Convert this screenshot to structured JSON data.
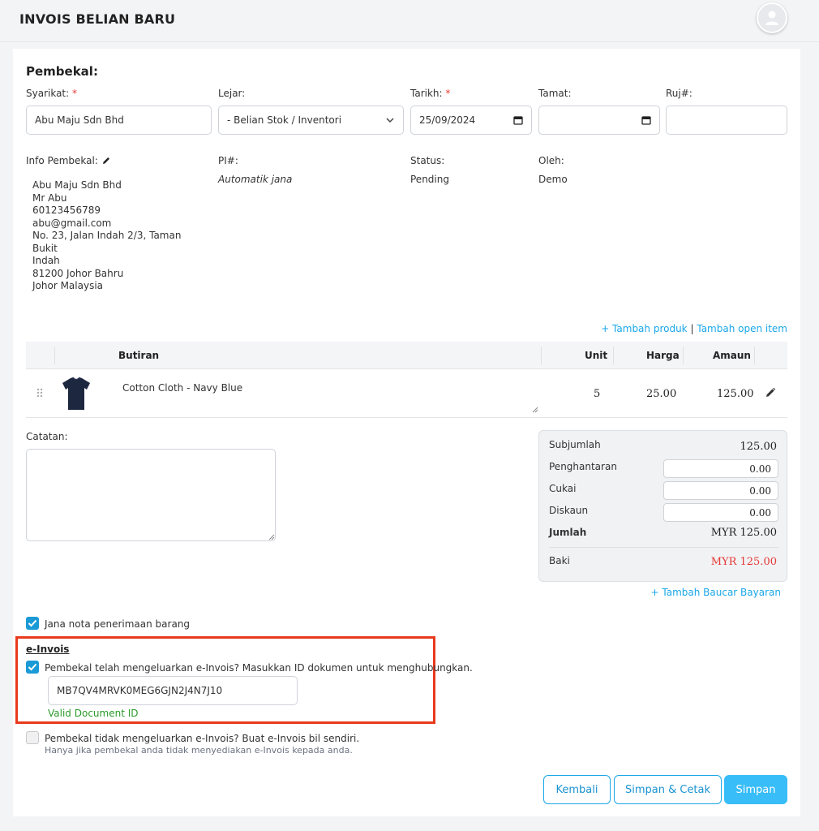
{
  "header": {
    "title": "INVOIS BELIAN BARU",
    "avatar_icon": "user-icon"
  },
  "supplier": {
    "heading": "Pembekal:",
    "company_label": "Syarikat:",
    "company_value": "Abu Maju Sdn Bhd",
    "ledger_label": "Lejar:",
    "ledger_value": "- Belian Stok / Inventori",
    "date_label": "Tarikh:",
    "date_value": "25/09/2024",
    "end_label": "Tamat:",
    "end_value": "",
    "ref_label": "Ruj#:",
    "ref_value": "",
    "required_mark": "*"
  },
  "info": {
    "label": "Info Pembekal:",
    "address_lines": [
      "Abu Maju Sdn Bhd",
      "Mr Abu",
      "60123456789",
      "abu@gmail.com",
      "No. 23, Jalan Indah 2/3, Taman Bukit",
      "Indah",
      "81200 Johor Bahru",
      "Johor Malaysia"
    ],
    "pi_label": "PI#:",
    "pi_value": "Automatik jana",
    "status_label": "Status:",
    "status_value": "Pending",
    "by_label": "Oleh:",
    "by_value": "Demo"
  },
  "item_links": {
    "add_product": "+ Tambah produk",
    "separator": "|",
    "add_open_item": "Tambah open item"
  },
  "table": {
    "headers": {
      "details": "Butiran",
      "unit": "Unit",
      "price": "Harga",
      "amount": "Amaun"
    },
    "rows": [
      {
        "details": "Cotton Cloth - Navy Blue",
        "unit": "5",
        "price": "25.00",
        "amount": "125.00"
      }
    ]
  },
  "notes": {
    "label": "Catatan:",
    "value": ""
  },
  "summary": {
    "subtotal_label": "Subjumlah",
    "subtotal_value": "125.00",
    "shipping_label": "Penghantaran",
    "shipping_value": "0.00",
    "tax_label": "Cukai",
    "tax_value": "0.00",
    "discount_label": "Diskaun",
    "discount_value": "0.00",
    "total_label": "Jumlah",
    "total_value": "MYR 125.00",
    "balance_label": "Baki",
    "balance_value": "MYR 125.00",
    "balance_color": "#e53935",
    "add_payment": "+ Tambah Baucar Bayaran"
  },
  "grn": {
    "label": "Jana nota penerimaan barang",
    "checked": true
  },
  "einvoice": {
    "heading": "e-Invois",
    "supplier_issued_label": "Pembekal telah mengeluarkan e-Invois? Masukkan ID dokumen untuk menghubungkan.",
    "document_id": "MB7QV4MRVK0MEG6GJN2J4N7J10",
    "valid_message": "Valid Document ID",
    "self_bill_label": "Pembekal tidak mengeluarkan e-Invois? Buat e-Invois bil sendiri.",
    "self_bill_hint": "Hanya jika pembekal anda tidak menyediakan e-Invois kepada anda.",
    "highlight_color": "#e8391d"
  },
  "actions": {
    "back": "Kembali",
    "save_print": "Simpan & Cetak",
    "save": "Simpan"
  }
}
